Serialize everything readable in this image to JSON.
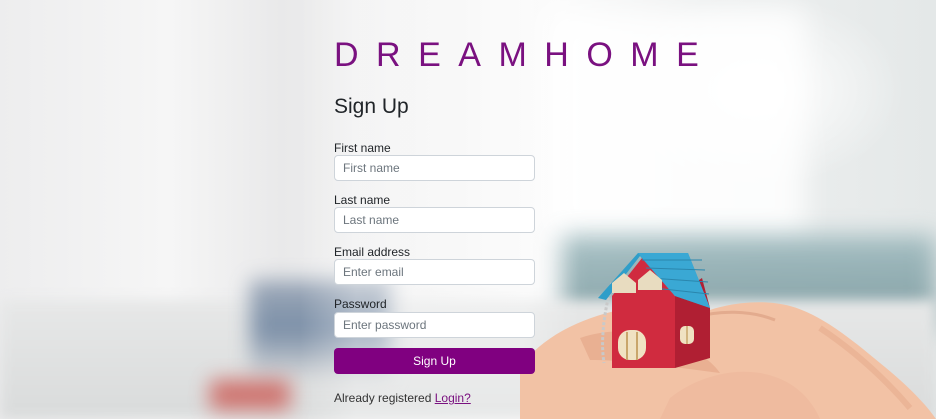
{
  "brand": {
    "name": "DREAMHOME",
    "color": "#7a1180"
  },
  "form": {
    "title": "Sign Up",
    "fields": [
      {
        "label": "First name",
        "placeholder": "First name",
        "value": ""
      },
      {
        "label": "Last name",
        "placeholder": "Last name",
        "value": ""
      },
      {
        "label": "Email address",
        "placeholder": "Enter email",
        "value": ""
      },
      {
        "label": "Password",
        "placeholder": "Enter password",
        "value": ""
      }
    ],
    "submit_label": "Sign Up",
    "submit_color": "#800080"
  },
  "footer": {
    "text": "Already registered ",
    "link_label": "Login?"
  },
  "background": {
    "image_subject": "hand holding toy house"
  }
}
